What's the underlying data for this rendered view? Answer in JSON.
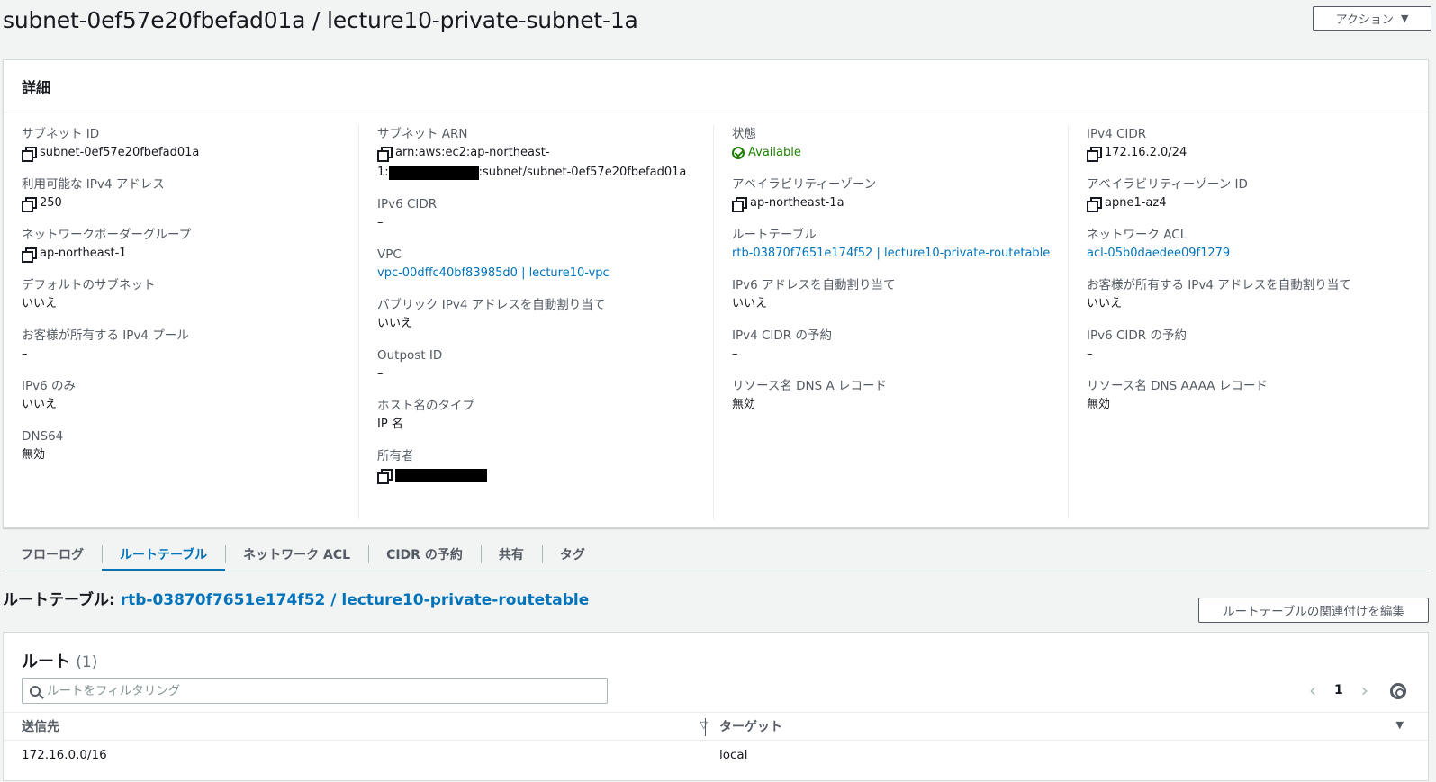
{
  "page": {
    "title": "subnet-0ef57e20fbefad01a / lecture10-private-subnet-1a",
    "actions_label": "アクション"
  },
  "details": {
    "heading": "詳細",
    "col1": [
      {
        "label": "サブネット ID",
        "value": "subnet-0ef57e20fbefad01a"
      },
      {
        "label": "利用可能な IPv4 アドレス",
        "value": "250"
      },
      {
        "label": "ネットワークボーダーグループ",
        "value": "ap-northeast-1"
      },
      {
        "label": "デフォルトのサブネット",
        "value": "いいえ"
      },
      {
        "label": "お客様が所有する IPv4 プール",
        "value": "–"
      },
      {
        "label": "IPv6 のみ",
        "value": "いいえ"
      },
      {
        "label": "DNS64",
        "value": "無効"
      }
    ],
    "col2": [
      {
        "label": "サブネット ARN",
        "value_line1": "arn:aws:ec2:ap-northeast-",
        "value_line2_prefix": "1:",
        "value_line2_suffix": ":subnet/subnet-0ef57e20fbefad01a"
      },
      {
        "label": "IPv6 CIDR",
        "value": "–"
      },
      {
        "label": "VPC",
        "value": "vpc-00dffc40bf83985d0 | lecture10-vpc"
      },
      {
        "label": "パブリック IPv4 アドレスを自動割り当て",
        "value": "いいえ"
      },
      {
        "label": "Outpost ID",
        "value": "–"
      },
      {
        "label": "ホスト名のタイプ",
        "value": "IP 名"
      },
      {
        "label": "所有者",
        "value": ""
      }
    ],
    "col3": [
      {
        "label": "状態",
        "value": "Available"
      },
      {
        "label": "アベイラビリティーゾーン",
        "value": "ap-northeast-1a"
      },
      {
        "label": "ルートテーブル",
        "value": "rtb-03870f7651e174f52 | lecture10-private-routetable"
      },
      {
        "label": "IPv6 アドレスを自動割り当て",
        "value": "いいえ"
      },
      {
        "label": "IPv4 CIDR の予約",
        "value": "–"
      },
      {
        "label": "リソース名 DNS A レコード",
        "value": "無効"
      }
    ],
    "col4": [
      {
        "label": "IPv4 CIDR",
        "value": "172.16.2.0/24"
      },
      {
        "label": "アベイラビリティーゾーン ID",
        "value": "apne1-az4"
      },
      {
        "label": "ネットワーク ACL",
        "value": "acl-05b0daedee09f1279"
      },
      {
        "label": "お客様が所有する IPv4 アドレスを自動割り当て",
        "value": "いいえ"
      },
      {
        "label": "IPv6 CIDR の予約",
        "value": "–"
      },
      {
        "label": "リソース名 DNS AAAA レコード",
        "value": "無効"
      }
    ]
  },
  "tabs": [
    {
      "label": "フローログ",
      "active": false
    },
    {
      "label": "ルートテーブル",
      "active": true
    },
    {
      "label": "ネットワーク ACL",
      "active": false
    },
    {
      "label": "CIDR の予約",
      "active": false
    },
    {
      "label": "共有",
      "active": false
    },
    {
      "label": "タグ",
      "active": false
    }
  ],
  "route_table": {
    "heading_prefix": "ルートテーブル: ",
    "heading_link": "rtb-03870f7651e174f52 / lecture10-private-routetable",
    "edit_button": "ルートテーブルの関連付けを編集"
  },
  "routes": {
    "title": "ルート",
    "count": "(1)",
    "filter_placeholder": "ルートをフィルタリング",
    "page": "1",
    "columns": [
      "送信先",
      "ターゲット"
    ],
    "rows": [
      {
        "destination": "172.16.0.0/16",
        "target": "local"
      }
    ]
  },
  "colors": {
    "link": "#0073bb",
    "success": "#1d8102",
    "text": "#16191f",
    "muted": "#545b64"
  }
}
